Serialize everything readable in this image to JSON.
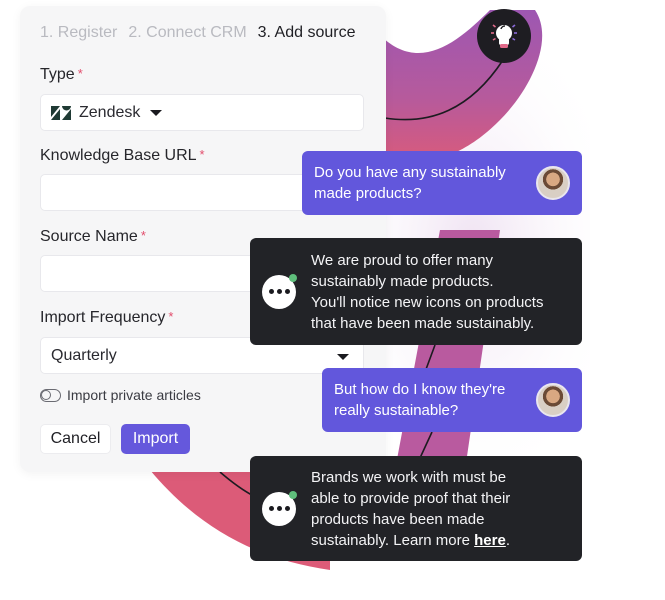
{
  "steps": [
    {
      "label": "1. Register",
      "active": false
    },
    {
      "label": "2. Connect CRM",
      "active": false
    },
    {
      "label": "3. Add source",
      "active": true
    }
  ],
  "form": {
    "type": {
      "label": "Type",
      "required_mark": "*",
      "value": "Zendesk",
      "icon": "zendesk-logo"
    },
    "kb_url": {
      "label": "Knowledge Base URL",
      "required_mark": "*",
      "value": "",
      "placeholder": ""
    },
    "source_name": {
      "label": "Source Name",
      "required_mark": "*",
      "value": "",
      "placeholder": ""
    },
    "import_frequency": {
      "label": "Import Frequency",
      "required_mark": "*",
      "value": "Quarterly"
    },
    "private_toggle": {
      "label": "Import private articles",
      "checked": false
    },
    "cancel_label": "Cancel",
    "import_label": "Import"
  },
  "chat": {
    "messages": [
      {
        "role": "user",
        "text": "Do you have any sustainably made products?"
      },
      {
        "role": "bot",
        "lines": [
          "We are proud to offer many",
          "sustainably made products.",
          "You'll notice new icons on products",
          "that have been made sustainably."
        ]
      },
      {
        "role": "user",
        "text": "But how do I know they're really sustainable?"
      },
      {
        "role": "bot",
        "lines": [
          "Brands we work with must be",
          "able to provide proof that their",
          "products have been made"
        ],
        "last_line_prefix": "sustainably. Learn more ",
        "link_text": "here",
        "last_line_suffix": "."
      }
    ]
  },
  "colors": {
    "accent": "#6257dc",
    "bot_bubble": "#222327",
    "required": "#e24c6b",
    "path_purple": "#9d58b0",
    "path_pink": "#dc5c7c",
    "online": "#5fbf7c"
  }
}
